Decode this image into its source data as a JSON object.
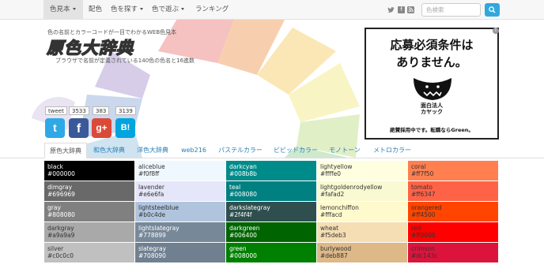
{
  "nav": {
    "items": [
      {
        "label": "色見本"
      },
      {
        "label": "配色"
      },
      {
        "label": "色を探す"
      },
      {
        "label": "色で遊ぶ"
      },
      {
        "label": "ランキング"
      }
    ],
    "social_icons": [
      "twitter-icon",
      "facebook-icon",
      "rss-icon"
    ],
    "search_placeholder": "色検索",
    "search_icon": "search-icon"
  },
  "header": {
    "subtitle": "色の名前とカラーコードが一目でわかるWEB色見本",
    "logo": "原色大辞典",
    "logo_sub": "ブラウザで名前が定義されている140色の色名と16進数"
  },
  "ad": {
    "line1": "応募必須条件は",
    "line2": "ありません。",
    "brand_line1": "面白法人",
    "brand_line2": "カヤック",
    "footer": "絶賛採用中です。転職ならGreen。"
  },
  "share": {
    "tweet_label": "tweet",
    "counts": [
      "3533",
      "383",
      "3139"
    ],
    "icons": [
      "twitter-share-icon",
      "facebook-share-icon",
      "googleplus-share-icon",
      "hatena-bookmark-icon"
    ],
    "glyphs": [
      "t",
      "f",
      "g+",
      "B!"
    ]
  },
  "tabs": [
    {
      "label": "原色大辞典"
    },
    {
      "label": "和色大辞典"
    },
    {
      "label": "洋色大辞典"
    },
    {
      "label": "web216"
    },
    {
      "label": "パステルカラー"
    },
    {
      "label": "ビビッドカラー"
    },
    {
      "label": "モノトーン"
    },
    {
      "label": "メトロカラー"
    }
  ],
  "colors": [
    [
      {
        "name": "black",
        "code": "#000000",
        "text": "#ffffff"
      },
      {
        "name": "dimgray",
        "code": "#696969",
        "text": "#ffffff"
      },
      {
        "name": "gray",
        "code": "#808080",
        "text": "#ffffff"
      },
      {
        "name": "darkgray",
        "code": "#a9a9a9",
        "text": "#333333"
      },
      {
        "name": "silver",
        "code": "#c0c0c0",
        "text": "#333333"
      }
    ],
    [
      {
        "name": "aliceblue",
        "code": "#f0f8ff",
        "text": "#333333"
      },
      {
        "name": "lavender",
        "code": "#e6e6fa",
        "text": "#333333"
      },
      {
        "name": "lightsteelblue",
        "code": "#b0c4de",
        "text": "#333333"
      },
      {
        "name": "lightslategray",
        "code": "#778899",
        "text": "#ffffff"
      },
      {
        "name": "slategray",
        "code": "#708090",
        "text": "#ffffff"
      }
    ],
    [
      {
        "name": "darkcyan",
        "code": "#008b8b",
        "text": "#ffffff"
      },
      {
        "name": "teal",
        "code": "#008080",
        "text": "#ffffff"
      },
      {
        "name": "darkslategray",
        "code": "#2f4f4f",
        "text": "#ffffff"
      },
      {
        "name": "darkgreen",
        "code": "#006400",
        "text": "#ffffff"
      },
      {
        "name": "green",
        "code": "#008000",
        "text": "#ffffff"
      }
    ],
    [
      {
        "name": "lightyellow",
        "code": "#ffffe0",
        "text": "#333333"
      },
      {
        "name": "lightgoldenrodyellow",
        "code": "#fafad2",
        "text": "#333333"
      },
      {
        "name": "lemonchiffon",
        "code": "#fffacd",
        "text": "#333333"
      },
      {
        "name": "wheat",
        "code": "#f5deb3",
        "text": "#333333"
      },
      {
        "name": "burlywood",
        "code": "#deb887",
        "text": "#333333"
      }
    ],
    [
      {
        "name": "coral",
        "code": "#ff7f50",
        "text": "#333333"
      },
      {
        "name": "tomato",
        "code": "#ff6347",
        "text": "#333333"
      },
      {
        "name": "orangered",
        "code": "#ff4500",
        "text": "#333333"
      },
      {
        "name": "red",
        "code": "#ff0000",
        "text": "#333333"
      },
      {
        "name": "crimson",
        "code": "#dc143c",
        "text": "#333333"
      }
    ]
  ]
}
